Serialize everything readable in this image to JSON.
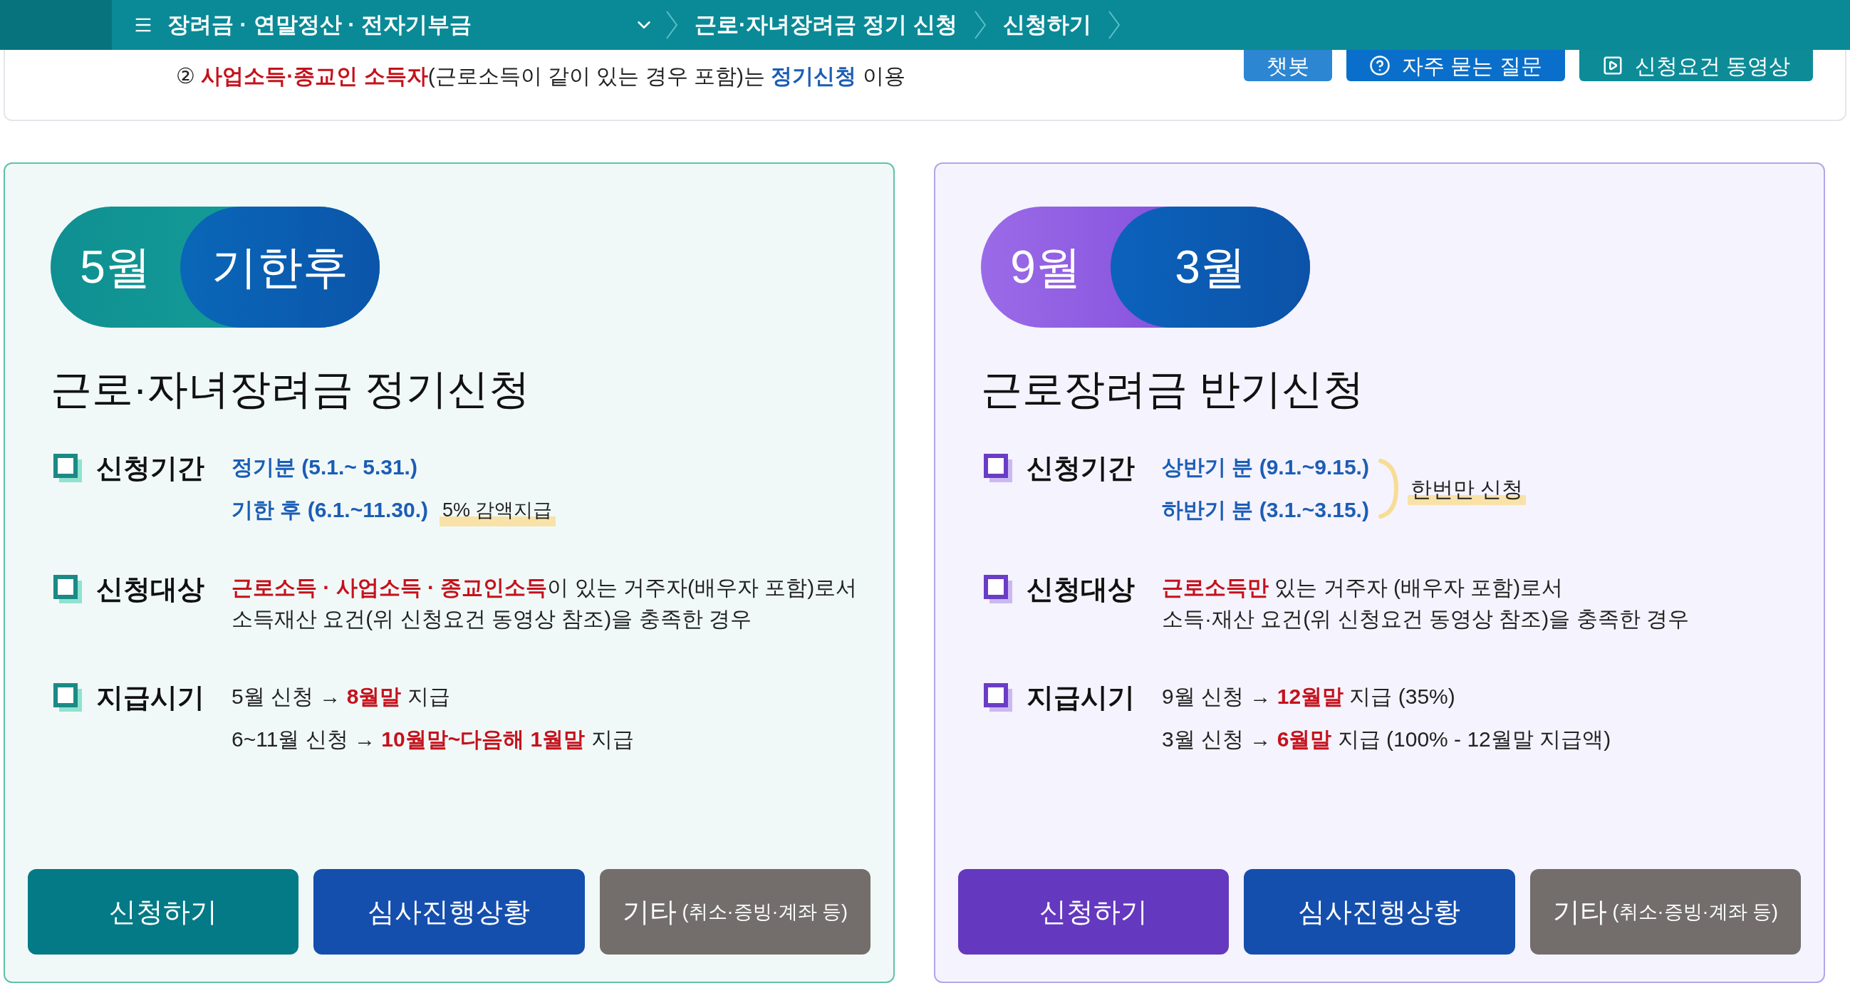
{
  "nav": {
    "breadcrumbs": [
      {
        "label": "장려금 · 연말정산 · 전자기부금",
        "dropdown": true
      },
      {
        "label": "근로·자녀장려금 정기 신청",
        "dropdown": false
      },
      {
        "label": "신청하기",
        "dropdown": false
      }
    ]
  },
  "notice": {
    "segments": [
      {
        "text": "② ",
        "color": "#222222",
        "bold": false
      },
      {
        "text": "사업소득·종교인 소득자",
        "color": "#c4121c",
        "bold": true
      },
      {
        "text": "(근로소득이 같이 있는 경우 포함)는 ",
        "color": "#222222",
        "bold": false
      },
      {
        "text": "정기신청",
        "color": "#1b5db5",
        "bold": true
      },
      {
        "text": " 이용",
        "color": "#222222",
        "bold": false
      }
    ]
  },
  "help_buttons": [
    {
      "label": "챗봇",
      "kind": "chatbot"
    },
    {
      "label": "자주 묻는 질문",
      "kind": "faq"
    },
    {
      "label": "신청요건 동영상",
      "kind": "video"
    }
  ],
  "cards": [
    {
      "kind": "regular",
      "months": [
        "5월",
        "기한후"
      ],
      "title": "근로·자녀장려금 정기신청",
      "rows": [
        {
          "label": "신청기간",
          "kind": "lines",
          "lines": [
            {
              "segments": [
                {
                  "text": "정기분 (5.1.~ 5.31.)",
                  "color": "#1b5db5",
                  "bold": true
                }
              ]
            },
            {
              "segments": [
                {
                  "text": "기한 후 (6.1.~11.30.)",
                  "color": "#1b5db5",
                  "bold": true
                }
              ],
              "note": "5% 감액지급"
            }
          ]
        },
        {
          "label": "신청대상",
          "kind": "paragraph",
          "lines": [
            {
              "segments": [
                {
                  "text": "근로소득 · 사업소득 · 종교인소득",
                  "color": "#c4121c",
                  "bold": true
                },
                {
                  "text": "이 있는 거주자(배우자 포함)로서",
                  "color": "#222222",
                  "bold": false
                }
              ]
            },
            {
              "segments": [
                {
                  "text": "소득재산 요건(위 신청요건 동영상 참조)을 충족한 경우",
                  "color": "#222222",
                  "bold": false
                }
              ]
            }
          ]
        },
        {
          "label": "지급시기",
          "kind": "lines",
          "lines": [
            {
              "segments": [
                {
                  "text": "5월 신청 → ",
                  "color": "#222222",
                  "bold": false
                },
                {
                  "text": "8월말",
                  "color": "#c4121c",
                  "bold": true
                },
                {
                  "text": " 지급",
                  "color": "#222222",
                  "bold": false
                }
              ]
            },
            {
              "segments": [
                {
                  "text": "6~11월 신청 → ",
                  "color": "#222222",
                  "bold": false
                },
                {
                  "text": "10월말~다음해 1월말",
                  "color": "#c4121c",
                  "bold": true
                },
                {
                  "text": " 지급",
                  "color": "#222222",
                  "bold": false
                }
              ]
            }
          ]
        }
      ],
      "buttons": [
        {
          "label": "신청하기",
          "kind": "apply"
        },
        {
          "label": "심사진행상황",
          "kind": "status"
        },
        {
          "label": "기타",
          "sub": "(취소·증빙·계좌 등)",
          "kind": "other"
        }
      ]
    },
    {
      "kind": "semiannual",
      "months": [
        "9월",
        "3월"
      ],
      "title": "근로장려금 반기신청",
      "rows": [
        {
          "label": "신청기간",
          "kind": "lines",
          "bracket_note": "한번만 신청",
          "lines": [
            {
              "segments": [
                {
                  "text": "상반기 분 (9.1.~9.15.)",
                  "color": "#1b5db5",
                  "bold": true
                }
              ]
            },
            {
              "segments": [
                {
                  "text": "하반기 분 (3.1.~3.15.)",
                  "color": "#1b5db5",
                  "bold": true
                }
              ]
            }
          ]
        },
        {
          "label": "신청대상",
          "kind": "paragraph",
          "lines": [
            {
              "segments": [
                {
                  "text": "근로소득만",
                  "color": "#c4121c",
                  "bold": true
                },
                {
                  "text": " 있는 거주자 (배우자 포함)로서",
                  "color": "#222222",
                  "bold": false
                }
              ]
            },
            {
              "segments": [
                {
                  "text": "소득·재산 요건(위 신청요건 동영상 참조)을 충족한 경우",
                  "color": "#222222",
                  "bold": false
                }
              ]
            }
          ]
        },
        {
          "label": "지급시기",
          "kind": "lines",
          "lines": [
            {
              "segments": [
                {
                  "text": "9월 신청 → ",
                  "color": "#222222",
                  "bold": false
                },
                {
                  "text": "12월말",
                  "color": "#c4121c",
                  "bold": true
                },
                {
                  "text": " 지급 (35%)",
                  "color": "#222222",
                  "bold": false
                }
              ]
            },
            {
              "segments": [
                {
                  "text": "3월 신청 → ",
                  "color": "#222222",
                  "bold": false
                },
                {
                  "text": "6월말",
                  "color": "#c4121c",
                  "bold": true
                },
                {
                  "text": " 지급 (100% - 12월말 지급액)",
                  "color": "#222222",
                  "bold": false
                }
              ]
            }
          ]
        }
      ],
      "buttons": [
        {
          "label": "신청하기",
          "kind": "apply"
        },
        {
          "label": "심사진행상황",
          "kind": "status"
        },
        {
          "label": "기타",
          "sub": "(취소·증빙·계좌 등)",
          "kind": "other"
        }
      ]
    }
  ]
}
